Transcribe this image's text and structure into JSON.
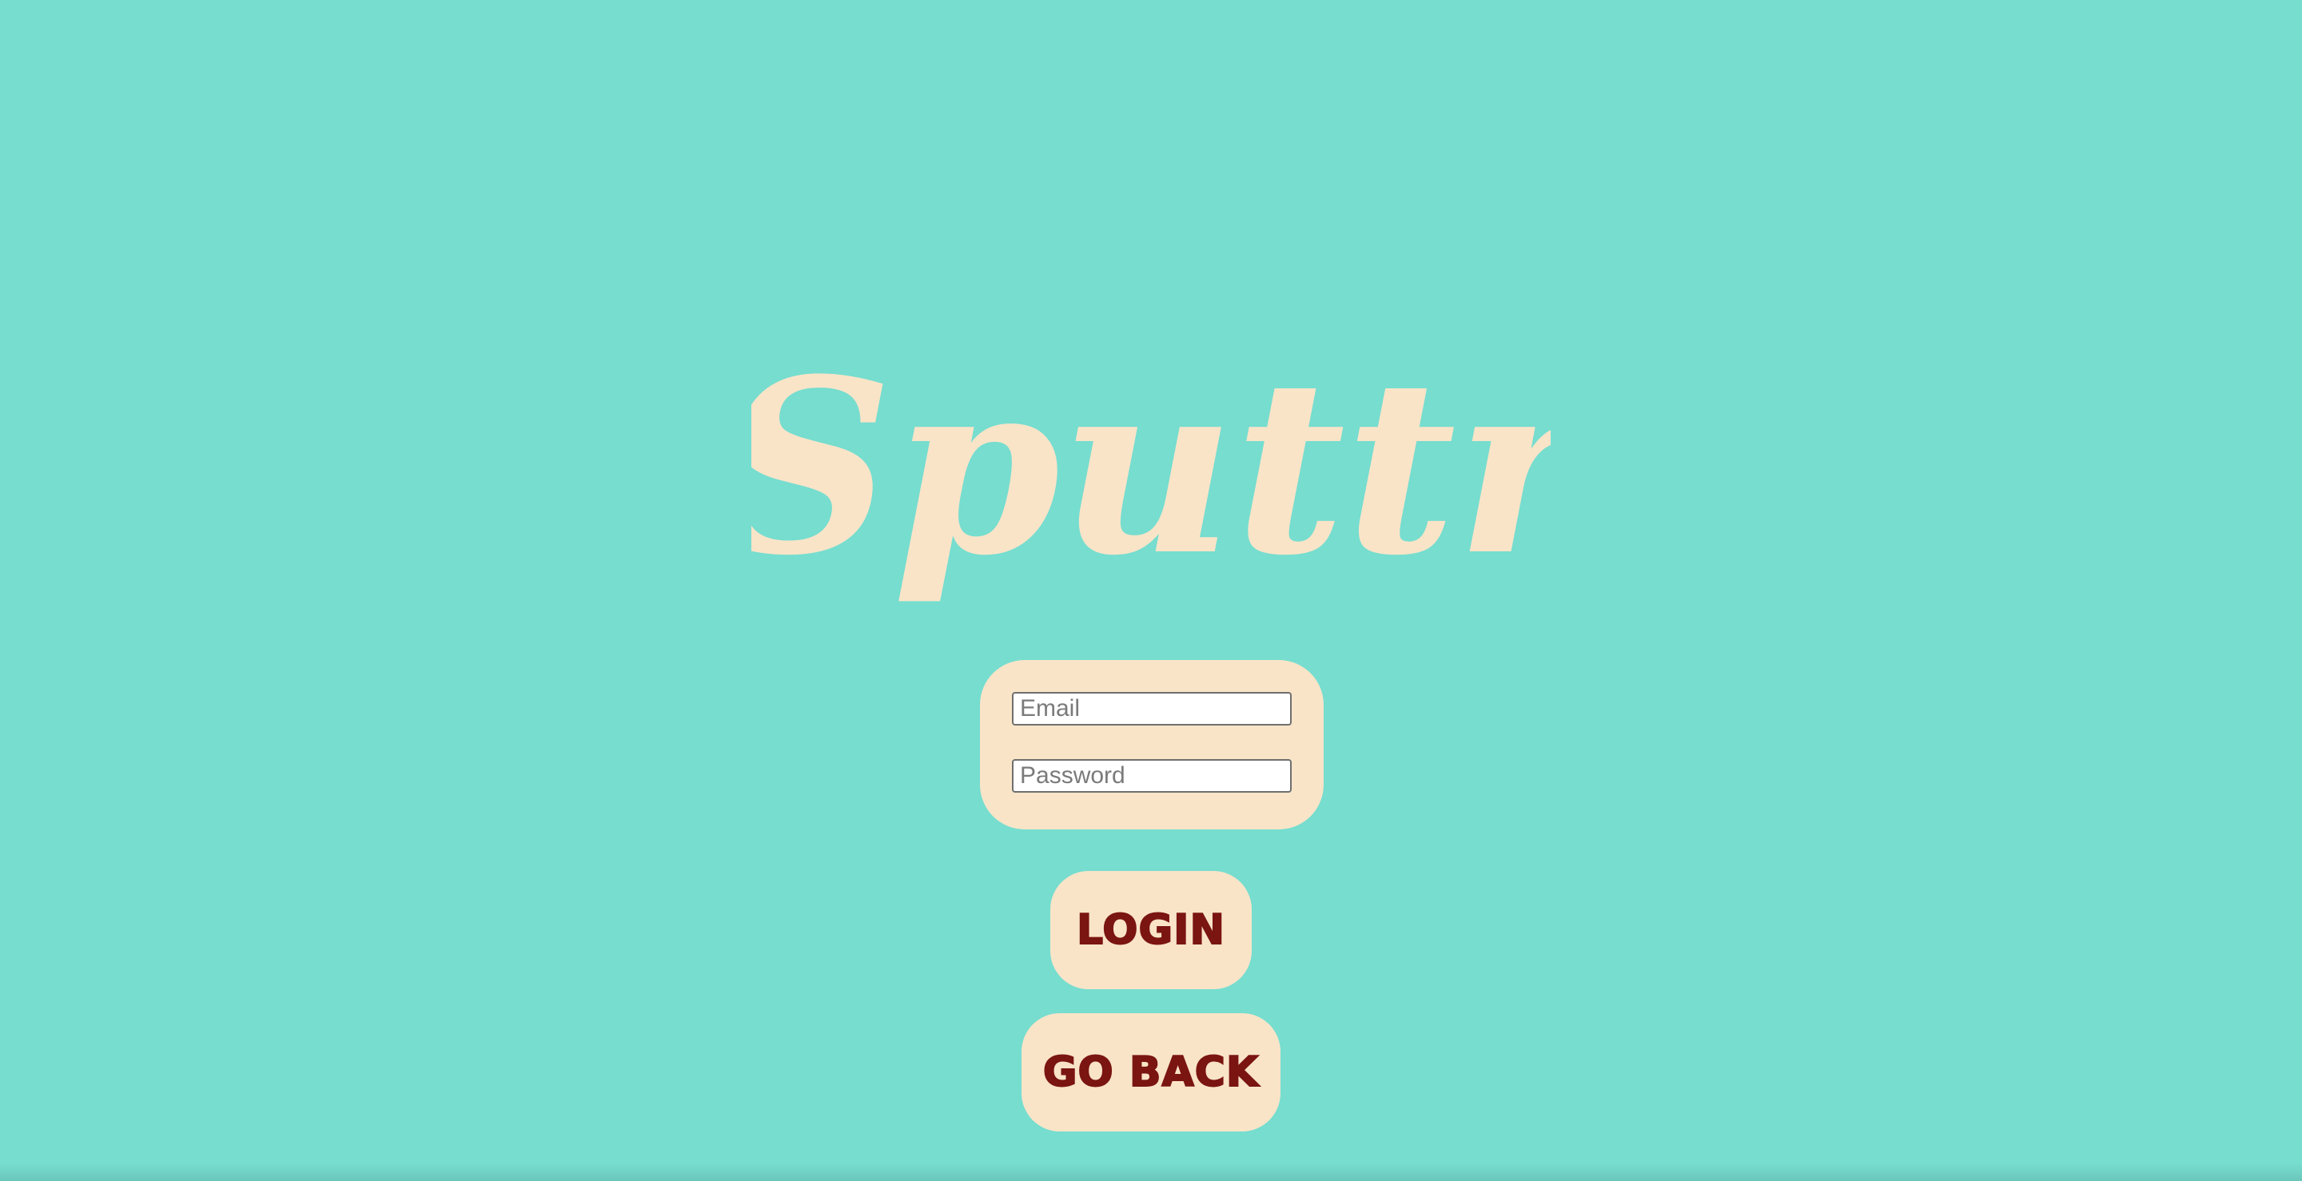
{
  "app": {
    "logo_text": "Sputtr"
  },
  "login_form": {
    "email_placeholder": "Email",
    "password_placeholder": "Password"
  },
  "actions": {
    "login_label": "LOGIN",
    "go_back_label": "GO BACK"
  },
  "colors": {
    "background": "#76ddcf",
    "cream": "#f9e4c8",
    "button_text": "#7a1512"
  }
}
